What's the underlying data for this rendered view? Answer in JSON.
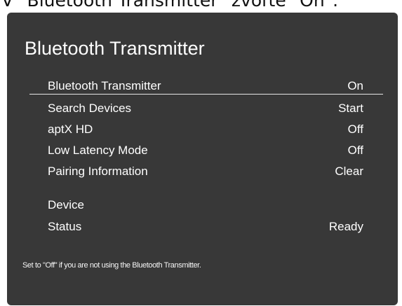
{
  "caption": "V \"Bluetooth Transmitter\" zvoľte \"On\".",
  "screen": {
    "title": "Bluetooth Transmitter",
    "items": [
      {
        "label": "Bluetooth Transmitter",
        "value": "On",
        "selected": true
      },
      {
        "label": "Search Devices",
        "value": "Start"
      },
      {
        "label": "aptX HD",
        "value": "Off"
      },
      {
        "label": "Low Latency Mode",
        "value": "Off"
      },
      {
        "label": "Pairing Information",
        "value": "Clear"
      }
    ],
    "info": [
      {
        "label": "Device",
        "value": ""
      },
      {
        "label": "Status",
        "value": "Ready"
      }
    ],
    "hint": "Set to \"Off\" if you are not using the Bluetooth Transmitter."
  },
  "colors": {
    "panel": "#383838",
    "text": "#ffffff",
    "highlight_line": "#e6e6e6"
  }
}
